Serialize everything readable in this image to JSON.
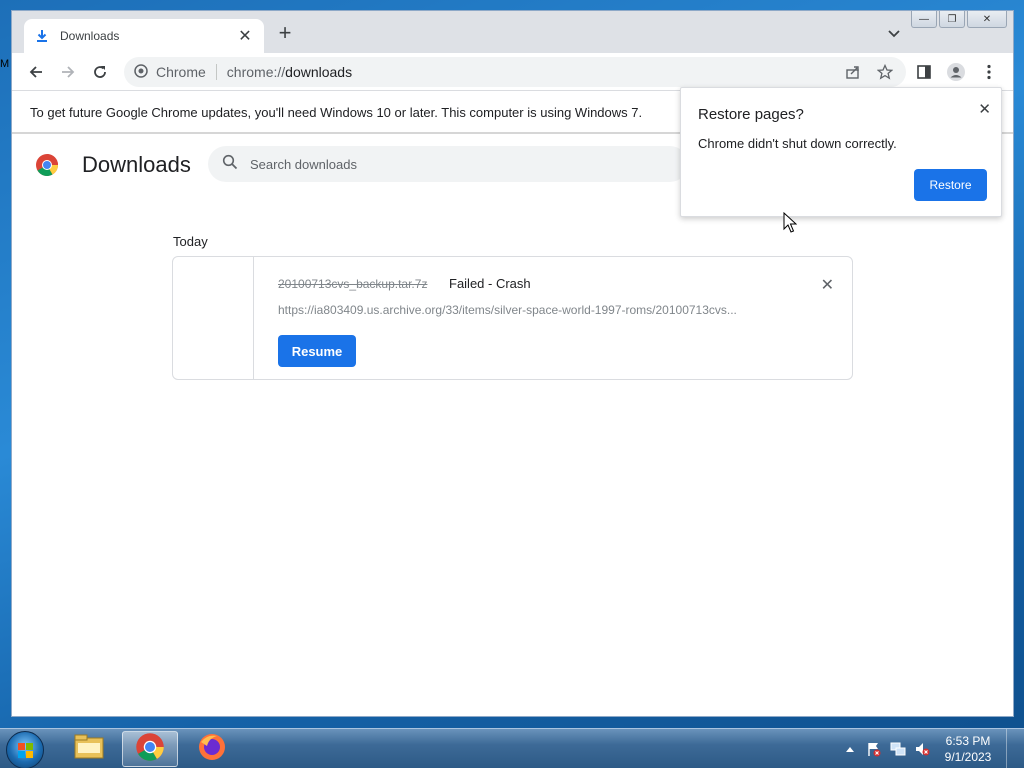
{
  "desktop": {
    "edge_text": "M"
  },
  "window": {
    "controls": {
      "minimize": "—",
      "maximize": "❐",
      "close": "✕"
    }
  },
  "tab": {
    "title": "Downloads",
    "icon": "download-icon",
    "close": "✕",
    "new_tab": "+"
  },
  "toolbar": {
    "chip_label": "Chrome",
    "url_scheme": "chrome://",
    "url_path": "downloads"
  },
  "infobar": {
    "text": "To get future Google Chrome updates, you'll need Windows 10 or later. This computer is using Windows 7."
  },
  "page": {
    "title": "Downloads",
    "search_placeholder": "Search downloads",
    "section_label": "Today"
  },
  "download": {
    "file_name": "20100713cvs_backup.tar.7z",
    "status": "Failed - Crash",
    "url": "https://ia803409.us.archive.org/33/items/silver-space-world-1997-roms/20100713cvs...",
    "resume_label": "Resume",
    "remove": "✕"
  },
  "restore_popup": {
    "title": "Restore pages?",
    "message": "Chrome didn't shut down correctly.",
    "button_label": "Restore",
    "close": "✕"
  },
  "taskbar": {
    "time": "6:53 PM",
    "date": "9/1/2023",
    "apps": [
      "file-explorer-icon",
      "chrome-icon",
      "firefox-icon"
    ]
  },
  "colors": {
    "accent": "#1a73e8",
    "tabstrip": "#dee1e6",
    "omnibox": "#f1f3f4"
  }
}
